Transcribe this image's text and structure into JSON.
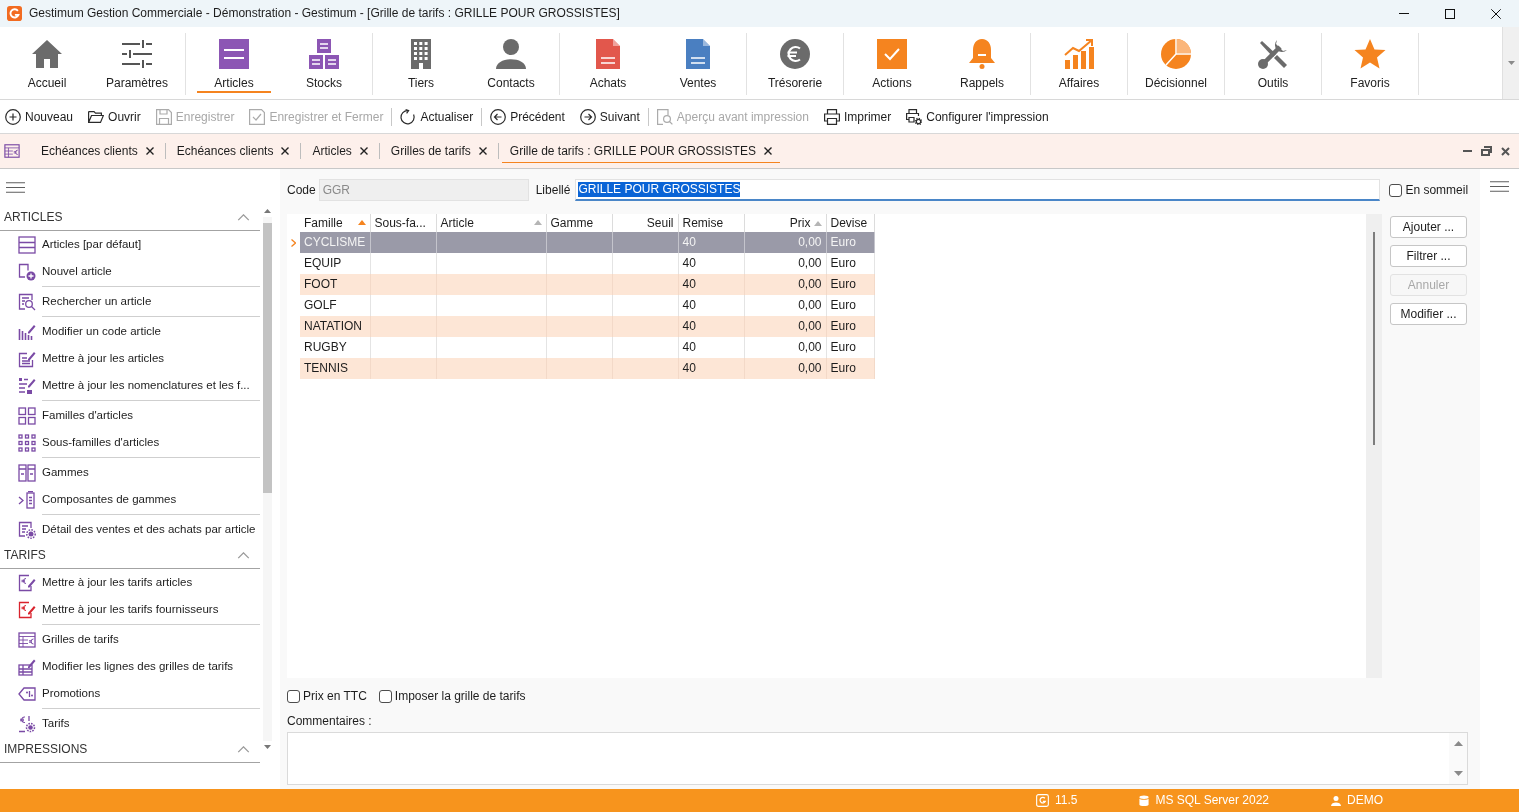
{
  "window": {
    "title": "Gestimum Gestion Commerciale - Démonstration - Gestimum - [Grille de tarifs : GRILLE POUR GROSSISTES]"
  },
  "ribbon": {
    "groups": [
      [
        {
          "label": "Accueil",
          "selected": false
        },
        {
          "label": "Paramètres",
          "selected": false
        }
      ],
      [
        {
          "label": "Articles",
          "selected": true
        },
        {
          "label": "Stocks",
          "selected": false
        }
      ],
      [
        {
          "label": "Tiers",
          "selected": false
        },
        {
          "label": "Contacts",
          "selected": false
        }
      ],
      [
        {
          "label": "Achats",
          "selected": false
        },
        {
          "label": "Ventes",
          "selected": false
        }
      ],
      [
        {
          "label": "Trésorerie",
          "selected": false
        }
      ],
      [
        {
          "label": "Actions",
          "selected": false
        },
        {
          "label": "Rappels",
          "selected": false
        }
      ],
      [
        {
          "label": "Affaires",
          "selected": false
        }
      ],
      [
        {
          "label": "Décisionnel",
          "selected": false
        }
      ],
      [
        {
          "label": "Outils",
          "selected": false
        }
      ],
      [
        {
          "label": "Favoris",
          "selected": false
        }
      ]
    ]
  },
  "toolbar": {
    "groups": [
      [
        {
          "label": "Nouveau",
          "disabled": false
        },
        {
          "label": "Ouvrir",
          "disabled": false
        },
        {
          "label": "Enregistrer",
          "disabled": true
        },
        {
          "label": "Enregistrer et Fermer",
          "disabled": true
        }
      ],
      [
        {
          "label": "Actualiser",
          "disabled": false
        }
      ],
      [
        {
          "label": "Précédent",
          "disabled": false
        },
        {
          "label": "Suivant",
          "disabled": false
        }
      ],
      [
        {
          "label": "Aperçu avant impression",
          "disabled": true
        },
        {
          "label": "Imprimer",
          "disabled": false
        },
        {
          "label": "Configurer l'impression",
          "disabled": false
        }
      ]
    ]
  },
  "document_tabs": [
    {
      "label": "Echéances clients",
      "selected": false
    },
    {
      "label": "Echéances clients",
      "selected": false
    },
    {
      "label": "Articles",
      "selected": false
    },
    {
      "label": "Grilles de tarifs",
      "selected": false
    },
    {
      "label": "Grille de tarifs : GRILLE POUR GROSSISTES",
      "selected": true
    }
  ],
  "sidebar": {
    "sections": [
      {
        "title": "ARTICLES",
        "expanded": true,
        "groups": [
          [
            "Articles [par défaut]",
            "Nouvel article"
          ],
          [
            "Rechercher un article"
          ],
          [
            "Modifier un code article",
            "Mettre à jour les articles",
            "Mettre à jour les nomenclatures et les f..."
          ],
          [
            "Familles d'articles",
            "Sous-familles d'articles"
          ],
          [
            "Gammes",
            "Composantes de gammes"
          ],
          [
            "Détail des ventes et des achats par article"
          ]
        ]
      },
      {
        "title": "TARIFS",
        "expanded": true,
        "groups": [
          [
            "Mettre à jour les tarifs articles",
            "Mettre à jour les tarifs fournisseurs"
          ],
          [
            "Grilles de tarifs",
            "Modifier les lignes des grilles de tarifs",
            "Promotions"
          ],
          [
            "Tarifs"
          ]
        ]
      },
      {
        "title": "IMPRESSIONS",
        "expanded": true
      }
    ]
  },
  "form": {
    "code": {
      "label": "Code",
      "value": "GGR",
      "disabled": true
    },
    "libelle": {
      "label": "Libellé",
      "value": "GRILLE POUR GROSSISTES",
      "text_selected": true
    },
    "sleeping": {
      "label": "En sommeil",
      "checked": false
    }
  },
  "table": {
    "columns": [
      {
        "label": "Famille",
        "kind": "text",
        "sortable": true,
        "sorted": true
      },
      {
        "label": "Sous-fa...",
        "kind": "text",
        "sortable": false,
        "sorted": false
      },
      {
        "label": "Article",
        "kind": "text",
        "sortable": true,
        "sorted": false
      },
      {
        "label": "Gamme",
        "kind": "text",
        "sortable": false,
        "sorted": false
      },
      {
        "label": "Seuil",
        "kind": "number",
        "sortable": false,
        "sorted": false
      },
      {
        "label": "Remise",
        "kind": "text",
        "sortable": false,
        "sorted": false
      },
      {
        "label": "Prix",
        "kind": "number",
        "sortable": true,
        "sorted": false
      },
      {
        "label": "Devise",
        "kind": "text",
        "sortable": false,
        "sorted": false
      }
    ],
    "rows": [
      {
        "famille": "CYCLISME",
        "remise": "40",
        "prix": "0,00",
        "devise": "Euro",
        "selected": true
      },
      {
        "famille": "EQUIP",
        "remise": "40",
        "prix": "0,00",
        "devise": "Euro",
        "selected": false
      },
      {
        "famille": "FOOT",
        "remise": "40",
        "prix": "0,00",
        "devise": "Euro",
        "selected": false
      },
      {
        "famille": "GOLF",
        "remise": "40",
        "prix": "0,00",
        "devise": "Euro",
        "selected": false
      },
      {
        "famille": "NATATION",
        "remise": "40",
        "prix": "0,00",
        "devise": "Euro",
        "selected": false
      },
      {
        "famille": "RUGBY",
        "remise": "40",
        "prix": "0,00",
        "devise": "Euro",
        "selected": false
      },
      {
        "famille": "TENNIS",
        "remise": "40",
        "prix": "0,00",
        "devise": "Euro",
        "selected": false
      }
    ]
  },
  "buttons": [
    {
      "label": "Ajouter ...",
      "disabled": false
    },
    {
      "label": "Filtrer ...",
      "disabled": false
    },
    {
      "label": "Annuler",
      "disabled": true
    },
    {
      "label": "Modifier ...",
      "disabled": false
    }
  ],
  "options": [
    {
      "label": "Prix en TTC",
      "checked": false
    },
    {
      "label": "Imposer la grille de tarifs",
      "checked": false
    }
  ],
  "comments": {
    "label": "Commentaires :"
  },
  "status_bar": [
    {
      "text": "11.5"
    },
    {
      "text": "MS SQL Server 2022"
    },
    {
      "text": "DEMO"
    }
  ]
}
